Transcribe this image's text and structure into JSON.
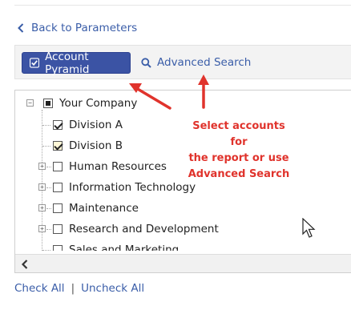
{
  "nav": {
    "back_label": "Back to Parameters"
  },
  "toolbar": {
    "pyramid_label": "Account Pyramid",
    "advanced_search_label": "Advanced Search"
  },
  "tree": {
    "root": {
      "label": "Your Company",
      "state": "partial"
    },
    "items": [
      {
        "label": "Division A",
        "checked": true,
        "expandable": false
      },
      {
        "label": "Division B",
        "checked": true,
        "expandable": false
      },
      {
        "label": "Human Resources",
        "checked": false,
        "expandable": true
      },
      {
        "label": "Information Technology",
        "checked": false,
        "expandable": true
      },
      {
        "label": "Maintenance",
        "checked": false,
        "expandable": true
      },
      {
        "label": "Research and Development",
        "checked": false,
        "expandable": true
      },
      {
        "label": "Sales and Marketing",
        "checked": false,
        "expandable": false
      }
    ]
  },
  "annotation": {
    "line1": "Select accounts for",
    "line2": "the report or use",
    "line3": "Advanced Search"
  },
  "footer": {
    "check_all": "Check All",
    "separator": "|",
    "uncheck_all": "Uncheck All"
  },
  "colors": {
    "primary": "#3b53a4",
    "link": "#3a5da8",
    "annotation": "#e0332c"
  },
  "icons": [
    "chevron-left-icon",
    "checkbox-check-icon",
    "search-icon",
    "expand-plus-icon",
    "collapse-minus-icon",
    "mouse-cursor-icon",
    "scroll-left-arrow-icon"
  ]
}
